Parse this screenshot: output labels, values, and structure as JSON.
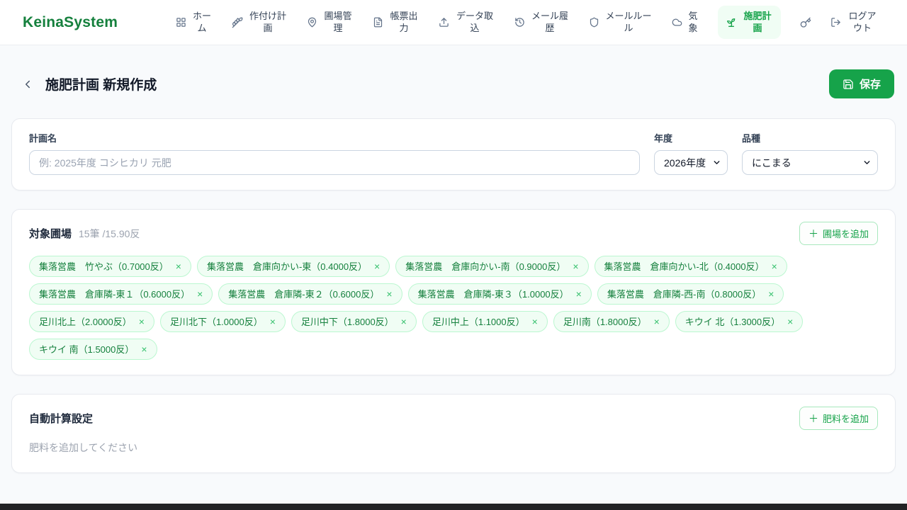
{
  "app": {
    "name": "KeinaSystem"
  },
  "nav": {
    "items": [
      {
        "label": "ホーム"
      },
      {
        "label": "作付け計画"
      },
      {
        "label": "圃場管理"
      },
      {
        "label": "帳票出力"
      },
      {
        "label": "データ取込"
      },
      {
        "label": "メール履歴"
      },
      {
        "label": "メールルール"
      },
      {
        "label": "気象"
      },
      {
        "label": "施肥計画"
      },
      {
        "label": "ログアウト"
      }
    ]
  },
  "page": {
    "title": "施肥計画 新規作成",
    "save_label": "保存"
  },
  "plan_form": {
    "name_label": "計画名",
    "name_placeholder": "例: 2025年度 コシヒカリ 元肥",
    "name_value": "",
    "year_label": "年度",
    "year_value": "2026年度",
    "variety_label": "品種",
    "variety_value": "にこまる"
  },
  "fields_section": {
    "title": "対象圃場",
    "summary": "15筆 /15.90反",
    "add_button_label": "圃場を追加",
    "chips": [
      "集落営農　竹やぶ（0.7000反）",
      "集落営農　倉庫向かい-東（0.4000反）",
      "集落営農　倉庫向かい-南（0.9000反）",
      "集落営農　倉庫向かい-北（0.4000反）",
      "集落営農　倉庫隣-東１（0.6000反）",
      "集落営農　倉庫隣-東２（0.6000反）",
      "集落営農　倉庫隣-東３（1.0000反）",
      "集落営農　倉庫隣-西-南（0.8000反）",
      "足川北上（2.0000反）",
      "足川北下（1.0000反）",
      "足川中下（1.8000反）",
      "足川中上（1.1000反）",
      "足川南（1.8000反）",
      "キウイ 北（1.3000反）",
      "キウイ 南（1.5000反）"
    ]
  },
  "fertilizer_section": {
    "title": "自動計算設定",
    "add_button_label": "肥料を追加",
    "empty_message": "肥料を追加してください"
  },
  "ui": {
    "plus_glyph": "＋",
    "remove_glyph": "×"
  },
  "colors": {
    "primary_green": "#16a34a",
    "logo_green": "#15803d",
    "chip_bg": "#f0fdf4",
    "chip_border": "#bbf7d0",
    "chip_text": "#15803d",
    "page_bg": "#f8fafc",
    "muted_text": "#9ca3af"
  }
}
